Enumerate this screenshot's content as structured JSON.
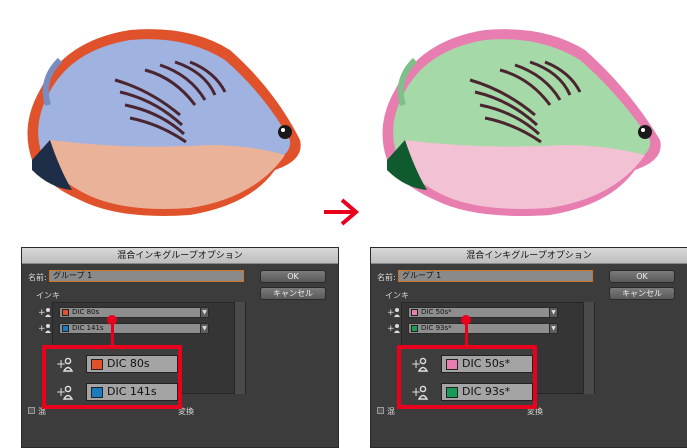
{
  "colors": {
    "accent_red": "#e8001c",
    "before_orange": "#e0522b",
    "before_blue": "#1a7bbf",
    "after_pink": "#e87eb0",
    "after_green": "#1a9b55"
  },
  "arrow_icon": "right-arrow-icon",
  "before": {
    "dialog": {
      "title": "混合インキグループオプション",
      "name_label": "名前:",
      "name_value": "グループ 1",
      "ok_label": "OK",
      "cancel_label": "キャンセル",
      "ink_label": "インキ",
      "inks": [
        {
          "label": "DIC 80s",
          "color": "#e0522b"
        },
        {
          "label": "DIC 141s",
          "color": "#1a7bbf"
        }
      ],
      "checkbox_text_left": "混",
      "checkbox_text_right": "変換"
    },
    "zoom_inks": [
      {
        "label": "DIC 80s",
        "color": "#e0522b"
      },
      {
        "label": "DIC 141s",
        "color": "#1a7bbf"
      }
    ]
  },
  "after": {
    "dialog": {
      "title": "混合インキグループオプション",
      "name_label": "名前:",
      "name_value": "グループ 1",
      "ok_label": "OK",
      "cancel_label": "キャンセル",
      "ink_label": "インキ",
      "inks": [
        {
          "label": "DIC 50s*",
          "color": "#e87eb0"
        },
        {
          "label": "DIC 93s*",
          "color": "#1a9b55"
        }
      ],
      "checkbox_text_left": "混",
      "checkbox_text_right": "変換"
    },
    "zoom_inks": [
      {
        "label": "DIC 50s*",
        "color": "#e87eb0"
      },
      {
        "label": "DIC 93s*",
        "color": "#1a9b55"
      }
    ]
  }
}
